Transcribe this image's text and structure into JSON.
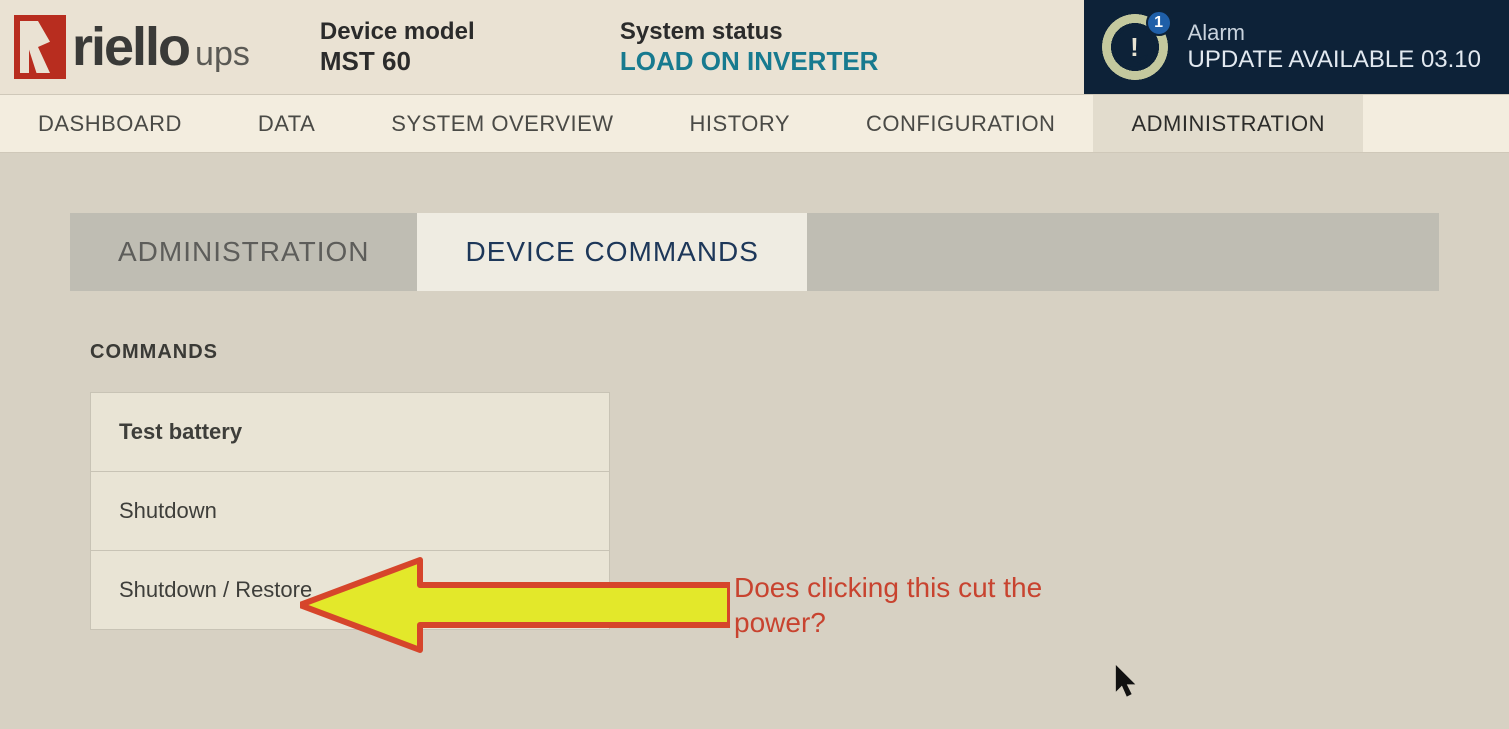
{
  "logo": {
    "word1": "riello",
    "word2": "ups"
  },
  "header": {
    "device_model_label": "Device model",
    "device_model_value": "MST 60",
    "system_status_label": "System status",
    "system_status_value": "LOAD ON INVERTER"
  },
  "alarm": {
    "badge": "1",
    "title": "Alarm",
    "message": "UPDATE AVAILABLE 03.10"
  },
  "nav": {
    "items": [
      "DASHBOARD",
      "DATA",
      "SYSTEM OVERVIEW",
      "HISTORY",
      "CONFIGURATION",
      "ADMINISTRATION"
    ],
    "active_index": 5
  },
  "subtabs": {
    "items": [
      "ADMINISTRATION",
      "DEVICE COMMANDS"
    ],
    "active_index": 1
  },
  "panel": {
    "title": "COMMANDS",
    "commands": [
      "Test battery",
      "Shutdown",
      "Shutdown / Restore"
    ]
  },
  "annotation": {
    "text": "Does clicking this cut the power?"
  }
}
